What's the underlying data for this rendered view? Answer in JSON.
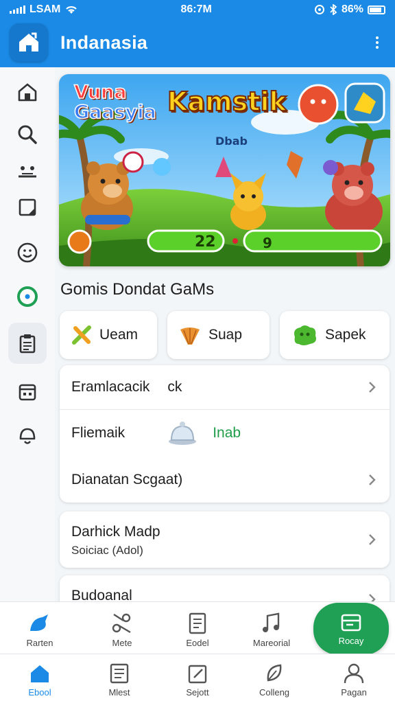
{
  "status": {
    "carrier": "LSAM",
    "time": "86:7M",
    "battery": "86%"
  },
  "app": {
    "title": "Indanasia"
  },
  "colors": {
    "primary": "#1a8ae6",
    "accent_green": "#1fa055",
    "background": "#f3f6f9"
  },
  "sidebar": {
    "items": [
      {
        "icon": "home-icon"
      },
      {
        "icon": "search-icon"
      },
      {
        "icon": "people-icon"
      },
      {
        "icon": "tablet-icon"
      },
      {
        "icon": "smiley-icon"
      },
      {
        "icon": "record-icon"
      },
      {
        "icon": "clipboard-icon",
        "active": true
      },
      {
        "icon": "calendar-icon"
      },
      {
        "icon": "bell-icon"
      }
    ]
  },
  "banner": {
    "left_title_1": "Vuna",
    "left_title_2": "Gaasyia",
    "center_title": "Kamstik",
    "subtitle": "Dbab",
    "score_1": "22",
    "score_2": "9"
  },
  "section": {
    "title": "Gomis Dondat GaMs"
  },
  "chips": [
    {
      "label": "Ueam",
      "icon": "cross-icon"
    },
    {
      "label": "Suap",
      "icon": "shell-icon"
    },
    {
      "label": "Sapek",
      "icon": "blob-icon"
    }
  ],
  "list1": {
    "rows": [
      {
        "label": "Eramlacacik",
        "extra": "ck"
      },
      {
        "label": "Fliemaik",
        "extra": "Inab"
      },
      {
        "label": "Dianatan Scgaat)"
      }
    ]
  },
  "list2": {
    "title": "Darhick Madp",
    "subtitle": "Soiciac (Adol)"
  },
  "list3": {
    "title": "Budoanal"
  },
  "bottom_top": [
    {
      "label": "Rarten",
      "icon": "bird-icon"
    },
    {
      "label": "Mete",
      "icon": "scissors-icon"
    },
    {
      "label": "Eodel",
      "icon": "document-icon"
    },
    {
      "label": "Mareorial",
      "icon": "music-icon"
    },
    {
      "label": "Rocay",
      "icon": "card-icon"
    }
  ],
  "bottom_nav": [
    {
      "label": "Ebool",
      "icon": "home-icon",
      "active": true
    },
    {
      "label": "Mlest",
      "icon": "list-icon"
    },
    {
      "label": "Sejott",
      "icon": "edit-icon"
    },
    {
      "label": "Colleng",
      "icon": "leaf-icon"
    },
    {
      "label": "Pagan",
      "icon": "person-icon"
    }
  ]
}
